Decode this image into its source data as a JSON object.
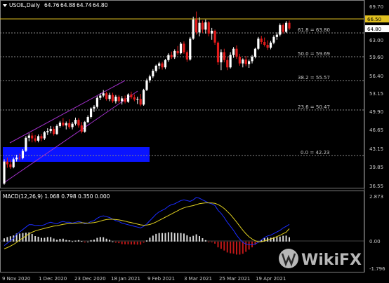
{
  "header": {
    "title": "USOIL,Daily",
    "open": "64.76",
    "high": "64.88",
    "low": "64.74",
    "close": "64.80"
  },
  "axis": {
    "price_ticks": [
      "69.70",
      "66.50",
      "63.80",
      "63.00",
      "59.60",
      "56.40",
      "53.15",
      "49.90",
      "46.65",
      "43.15",
      "39.85",
      "36.55"
    ],
    "date_ticks": [
      "9 Nov 2020",
      "1 Dec 2020",
      "23 Dec 2020",
      "18 Jan 2021",
      "9 Feb 2021",
      "3 Mar 2021",
      "25 Mar 2021",
      "19 Apr 2021"
    ],
    "price_current": "64.80",
    "price_line": "66.50"
  },
  "fibonacci": [
    {
      "label": "61.8 = 63.80"
    },
    {
      "label": "50.0 = 59.69"
    },
    {
      "label": "38.2 = 55.57"
    },
    {
      "label": "23.6 = 50.47"
    },
    {
      "label": "0.0 = 42.23"
    }
  ],
  "macd": {
    "label": "MACD(12,26,9) 1.068 0.798 0.350 0.000",
    "ticks": [
      "2.873",
      "0.00",
      "-1.796"
    ]
  },
  "watermark": {
    "text": "WikiFX"
  },
  "colors": {
    "background": "#000000",
    "bull_candle": "#ffffff",
    "bear_candle": "#e31b1b",
    "channel": "#a030c8",
    "support_zone": "#0a14ff",
    "price_line": "#e0c020",
    "macd_line": "#1a2cff",
    "signal_line": "#e0d020",
    "hist_pos": "#d8d8d8",
    "hist_neg": "#c01818"
  },
  "chart_data": {
    "type": "candlestick",
    "candles": [
      {
        "o": 37.3,
        "h": 41.6,
        "l": 37.1,
        "c": 41.2
      },
      {
        "o": 41.2,
        "h": 41.9,
        "l": 40.1,
        "c": 40.7
      },
      {
        "o": 40.7,
        "h": 41.5,
        "l": 39.9,
        "c": 40.2
      },
      {
        "o": 40.2,
        "h": 41.9,
        "l": 40.0,
        "c": 41.6
      },
      {
        "o": 41.6,
        "h": 42.4,
        "l": 41.2,
        "c": 41.9
      },
      {
        "o": 41.9,
        "h": 42.6,
        "l": 41.4,
        "c": 41.8
      },
      {
        "o": 41.8,
        "h": 43.4,
        "l": 41.6,
        "c": 43.1
      },
      {
        "o": 43.1,
        "h": 45.7,
        "l": 42.9,
        "c": 45.4
      },
      {
        "o": 45.4,
        "h": 46.2,
        "l": 44.8,
        "c": 45.8
      },
      {
        "o": 45.8,
        "h": 46.3,
        "l": 44.6,
        "c": 45.3
      },
      {
        "o": 45.3,
        "h": 45.9,
        "l": 44.6,
        "c": 44.9
      },
      {
        "o": 44.9,
        "h": 46.0,
        "l": 44.6,
        "c": 45.7
      },
      {
        "o": 45.7,
        "h": 46.1,
        "l": 44.8,
        "c": 45.3
      },
      {
        "o": 45.3,
        "h": 46.6,
        "l": 45.0,
        "c": 46.4
      },
      {
        "o": 46.4,
        "h": 47.1,
        "l": 45.9,
        "c": 46.6
      },
      {
        "o": 46.6,
        "h": 47.5,
        "l": 46.2,
        "c": 47.0
      },
      {
        "o": 47.0,
        "h": 47.4,
        "l": 45.8,
        "c": 46.1
      },
      {
        "o": 46.1,
        "h": 47.8,
        "l": 45.9,
        "c": 47.5
      },
      {
        "o": 47.5,
        "h": 48.4,
        "l": 47.2,
        "c": 48.1
      },
      {
        "o": 48.1,
        "h": 48.9,
        "l": 47.4,
        "c": 47.6
      },
      {
        "o": 47.6,
        "h": 48.3,
        "l": 46.9,
        "c": 48.0
      },
      {
        "o": 48.0,
        "h": 48.7,
        "l": 47.0,
        "c": 47.3
      },
      {
        "o": 47.3,
        "h": 48.2,
        "l": 46.9,
        "c": 47.9
      },
      {
        "o": 47.9,
        "h": 49.0,
        "l": 47.6,
        "c": 48.6
      },
      {
        "o": 48.6,
        "h": 48.9,
        "l": 47.2,
        "c": 47.6
      },
      {
        "o": 47.6,
        "h": 48.2,
        "l": 46.2,
        "c": 46.5
      },
      {
        "o": 46.5,
        "h": 48.4,
        "l": 46.3,
        "c": 48.2
      },
      {
        "o": 48.2,
        "h": 49.4,
        "l": 48.0,
        "c": 49.1
      },
      {
        "o": 49.1,
        "h": 50.8,
        "l": 48.8,
        "c": 50.6
      },
      {
        "o": 50.6,
        "h": 51.2,
        "l": 50.0,
        "c": 50.9
      },
      {
        "o": 50.9,
        "h": 52.8,
        "l": 50.6,
        "c": 52.5
      },
      {
        "o": 52.5,
        "h": 53.3,
        "l": 52.1,
        "c": 52.9
      },
      {
        "o": 52.9,
        "h": 53.9,
        "l": 52.6,
        "c": 53.3
      },
      {
        "o": 53.3,
        "h": 53.6,
        "l": 52.0,
        "c": 52.3
      },
      {
        "o": 52.3,
        "h": 53.4,
        "l": 51.9,
        "c": 53.0
      },
      {
        "o": 53.0,
        "h": 53.4,
        "l": 51.6,
        "c": 51.9
      },
      {
        "o": 51.9,
        "h": 53.0,
        "l": 51.5,
        "c": 52.7
      },
      {
        "o": 52.7,
        "h": 53.0,
        "l": 51.6,
        "c": 51.9
      },
      {
        "o": 51.9,
        "h": 52.8,
        "l": 51.3,
        "c": 52.4
      },
      {
        "o": 52.4,
        "h": 52.9,
        "l": 51.5,
        "c": 51.8
      },
      {
        "o": 51.8,
        "h": 53.3,
        "l": 51.6,
        "c": 53.1
      },
      {
        "o": 53.1,
        "h": 53.6,
        "l": 52.3,
        "c": 52.6
      },
      {
        "o": 52.6,
        "h": 53.1,
        "l": 51.9,
        "c": 52.2
      },
      {
        "o": 52.2,
        "h": 52.7,
        "l": 51.4,
        "c": 52.3
      },
      {
        "o": 52.3,
        "h": 53.2,
        "l": 51.0,
        "c": 51.3
      },
      {
        "o": 51.3,
        "h": 54.1,
        "l": 51.1,
        "c": 53.9
      },
      {
        "o": 53.9,
        "h": 55.9,
        "l": 53.7,
        "c": 55.6
      },
      {
        "o": 55.6,
        "h": 56.6,
        "l": 55.2,
        "c": 56.3
      },
      {
        "o": 56.3,
        "h": 57.6,
        "l": 56.0,
        "c": 57.3
      },
      {
        "o": 57.3,
        "h": 58.4,
        "l": 57.0,
        "c": 58.2
      },
      {
        "o": 58.2,
        "h": 58.9,
        "l": 57.6,
        "c": 58.6
      },
      {
        "o": 58.6,
        "h": 58.9,
        "l": 57.5,
        "c": 57.9
      },
      {
        "o": 57.9,
        "h": 59.4,
        "l": 57.6,
        "c": 59.2
      },
      {
        "o": 59.2,
        "h": 60.4,
        "l": 58.9,
        "c": 60.1
      },
      {
        "o": 60.1,
        "h": 60.7,
        "l": 59.4,
        "c": 59.7
      },
      {
        "o": 59.7,
        "h": 61.1,
        "l": 59.4,
        "c": 60.8
      },
      {
        "o": 60.8,
        "h": 61.7,
        "l": 60.1,
        "c": 60.4
      },
      {
        "o": 60.4,
        "h": 62.4,
        "l": 60.2,
        "c": 62.1
      },
      {
        "o": 62.1,
        "h": 62.5,
        "l": 60.3,
        "c": 60.6
      },
      {
        "o": 60.6,
        "h": 60.9,
        "l": 58.9,
        "c": 59.3
      },
      {
        "o": 59.3,
        "h": 63.3,
        "l": 59.1,
        "c": 63.0
      },
      {
        "o": 63.0,
        "h": 66.9,
        "l": 62.8,
        "c": 66.4
      },
      {
        "o": 66.4,
        "h": 67.8,
        "l": 63.7,
        "c": 64.1
      },
      {
        "o": 64.1,
        "h": 66.8,
        "l": 63.4,
        "c": 65.8
      },
      {
        "o": 65.8,
        "h": 66.2,
        "l": 64.0,
        "c": 64.6
      },
      {
        "o": 64.6,
        "h": 66.4,
        "l": 63.9,
        "c": 65.9
      },
      {
        "o": 65.9,
        "h": 66.1,
        "l": 63.4,
        "c": 63.9
      },
      {
        "o": 63.9,
        "h": 64.9,
        "l": 62.8,
        "c": 64.4
      },
      {
        "o": 64.4,
        "h": 64.6,
        "l": 61.9,
        "c": 62.3
      },
      {
        "o": 62.3,
        "h": 62.5,
        "l": 58.3,
        "c": 58.8
      },
      {
        "o": 58.8,
        "h": 61.1,
        "l": 57.4,
        "c": 60.6
      },
      {
        "o": 60.6,
        "h": 61.2,
        "l": 58.8,
        "c": 59.2
      },
      {
        "o": 59.2,
        "h": 59.8,
        "l": 57.4,
        "c": 57.9
      },
      {
        "o": 57.9,
        "h": 60.6,
        "l": 57.7,
        "c": 60.1
      },
      {
        "o": 60.1,
        "h": 61.5,
        "l": 59.6,
        "c": 61.2
      },
      {
        "o": 61.2,
        "h": 61.8,
        "l": 59.4,
        "c": 59.8
      },
      {
        "o": 59.8,
        "h": 60.3,
        "l": 58.2,
        "c": 58.6
      },
      {
        "o": 58.6,
        "h": 59.5,
        "l": 57.9,
        "c": 59.3
      },
      {
        "o": 59.3,
        "h": 59.9,
        "l": 58.1,
        "c": 58.5
      },
      {
        "o": 58.5,
        "h": 59.3,
        "l": 57.8,
        "c": 59.0
      },
      {
        "o": 59.0,
        "h": 60.1,
        "l": 58.6,
        "c": 59.8
      },
      {
        "o": 59.8,
        "h": 61.4,
        "l": 59.5,
        "c": 61.2
      },
      {
        "o": 61.2,
        "h": 63.3,
        "l": 61.0,
        "c": 63.0
      },
      {
        "o": 63.0,
        "h": 63.5,
        "l": 62.0,
        "c": 62.4
      },
      {
        "o": 62.4,
        "h": 63.2,
        "l": 61.6,
        "c": 61.9
      },
      {
        "o": 61.9,
        "h": 62.7,
        "l": 61.0,
        "c": 61.4
      },
      {
        "o": 61.4,
        "h": 62.6,
        "l": 61.1,
        "c": 62.3
      },
      {
        "o": 62.3,
        "h": 63.6,
        "l": 62.0,
        "c": 63.3
      },
      {
        "o": 63.3,
        "h": 64.1,
        "l": 62.8,
        "c": 63.7
      },
      {
        "o": 63.7,
        "h": 65.7,
        "l": 63.4,
        "c": 65.4
      },
      {
        "o": 65.4,
        "h": 65.7,
        "l": 63.9,
        "c": 64.2
      },
      {
        "o": 64.2,
        "h": 66.1,
        "l": 64.0,
        "c": 65.8
      },
      {
        "o": 65.8,
        "h": 66.2,
        "l": 64.5,
        "c": 64.8
      }
    ],
    "macd_line": [
      -0.25,
      -0.1,
      0.05,
      0.2,
      0.45,
      0.6,
      0.75,
      0.9,
      1.05,
      1.05,
      1.0,
      1.02,
      1.0,
      1.05,
      1.15,
      1.2,
      1.15,
      1.1,
      1.2,
      1.25,
      1.2,
      1.2,
      1.15,
      1.2,
      1.25,
      1.2,
      1.1,
      1.15,
      1.25,
      1.3,
      1.45,
      1.55,
      1.6,
      1.55,
      1.5,
      1.4,
      1.3,
      1.25,
      1.15,
      1.1,
      1.05,
      1.0,
      0.95,
      0.9,
      0.85,
      0.95,
      1.1,
      1.3,
      1.5,
      1.7,
      1.85,
      1.95,
      2.05,
      2.2,
      2.3,
      2.35,
      2.45,
      2.55,
      2.6,
      2.55,
      2.5,
      2.6,
      2.75,
      2.7,
      2.6,
      2.5,
      2.4,
      2.35,
      2.25,
      1.95,
      1.75,
      1.5,
      1.2,
      0.95,
      0.7,
      0.4,
      0.15,
      -0.05,
      -0.15,
      -0.2,
      -0.2,
      -0.15,
      -0.05,
      0.1,
      0.25,
      0.35,
      0.4,
      0.5,
      0.6,
      0.7,
      0.85,
      0.95,
      1.07
    ],
    "signal_line": [
      -0.45,
      -0.38,
      -0.28,
      -0.18,
      -0.05,
      0.1,
      0.22,
      0.35,
      0.48,
      0.58,
      0.66,
      0.72,
      0.77,
      0.82,
      0.87,
      0.92,
      0.96,
      0.99,
      1.03,
      1.07,
      1.1,
      1.12,
      1.13,
      1.14,
      1.16,
      1.17,
      1.16,
      1.15,
      1.16,
      1.18,
      1.22,
      1.27,
      1.33,
      1.37,
      1.39,
      1.39,
      1.37,
      1.35,
      1.31,
      1.27,
      1.22,
      1.18,
      1.13,
      1.09,
      1.04,
      1.02,
      1.03,
      1.06,
      1.13,
      1.22,
      1.32,
      1.42,
      1.52,
      1.62,
      1.72,
      1.82,
      1.92,
      2.02,
      2.1,
      2.16,
      2.2,
      2.24,
      2.3,
      2.36,
      2.39,
      2.41,
      2.41,
      2.4,
      2.38,
      2.31,
      2.2,
      2.06,
      1.88,
      1.68,
      1.45,
      1.21,
      0.96,
      0.71,
      0.49,
      0.3,
      0.16,
      0.05,
      -0.01,
      -0.01,
      0.04,
      0.1,
      0.16,
      0.23,
      0.31,
      0.39,
      0.49,
      0.58,
      0.8
    ],
    "macd_range": [
      -1.796,
      2.873
    ]
  }
}
